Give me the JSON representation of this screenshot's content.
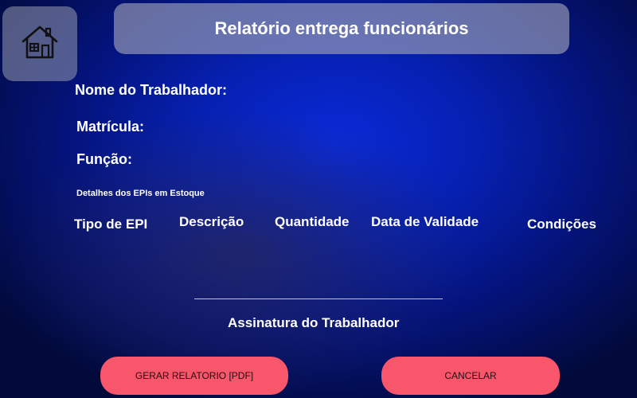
{
  "header": {
    "title": "Relatório entrega funcionários"
  },
  "home": {
    "icon": "home-icon"
  },
  "form": {
    "worker_name_label": "Nome do Trabalhador:",
    "registration_label": "Matrícula:",
    "role_label": "Função:",
    "section_title": "Detalhes dos EPIs em Estoque"
  },
  "table": {
    "columns": [
      "Tipo de EPI",
      "Descrição",
      "Quantidade",
      "Data de Validade",
      "Condições"
    ]
  },
  "signature": {
    "label": "Assinatura do Trabalhador"
  },
  "actions": {
    "generate_label": "GERAR RELATORIO [PDF]",
    "cancel_label": "CANCELAR",
    "button_color": "#f8566a"
  }
}
